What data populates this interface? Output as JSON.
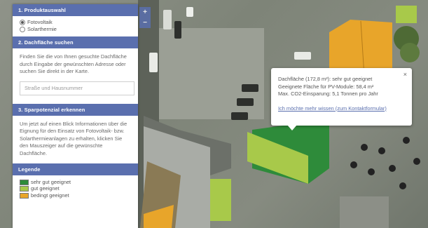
{
  "sections": [
    {
      "heading": "1. Produktauswahl"
    },
    {
      "heading": "2. Dachfläche suchen"
    },
    {
      "heading": "3. Sparpotenzial erkennen"
    },
    {
      "heading": "Legende"
    }
  ],
  "product_options": [
    {
      "label": "Fotovoltaik",
      "checked": true
    },
    {
      "label": "Solarthermie",
      "checked": false
    }
  ],
  "search": {
    "description": "Finden Sie die von Ihnen gesuchte Dachfläche durch Eingabe der gewünschten Adresse oder suchen Sie direkt in der Karte.",
    "placeholder": "Straße und Hausnummer"
  },
  "savings": {
    "description": "Um jetzt auf einen Blick Informationen über die Eignung für den Einsatz von Fotovoltaik- bzw. Solarthermieanlagen zu erhalten, klicken Sie den Mauszeiger auf die gewünschte Dachfläche."
  },
  "legend": [
    {
      "label": "sehr gut geeignet",
      "color": "#2e8b3a"
    },
    {
      "label": "gut geeignet",
      "color": "#a8c94a"
    },
    {
      "label": "bedingt geeignet",
      "color": "#e8a52a"
    }
  ],
  "popup": {
    "line1": "Dachfläche (172,8 m²): sehr gut geeignet",
    "line2": "Geeignete Fläche für PV-Module: 58,4 m²",
    "line3": "Max. CO2-Einsparung: 5,1 Tonnen pro Jahr",
    "link": "Ich möchte mehr wissen (zum Kontaktformular)",
    "close": "×"
  },
  "zoom": {
    "in": "+",
    "out": "−"
  },
  "colors": {
    "accent": "#5a6fae",
    "very_good": "#2e8b3a",
    "good": "#a8c94a",
    "conditional": "#e8a52a"
  }
}
